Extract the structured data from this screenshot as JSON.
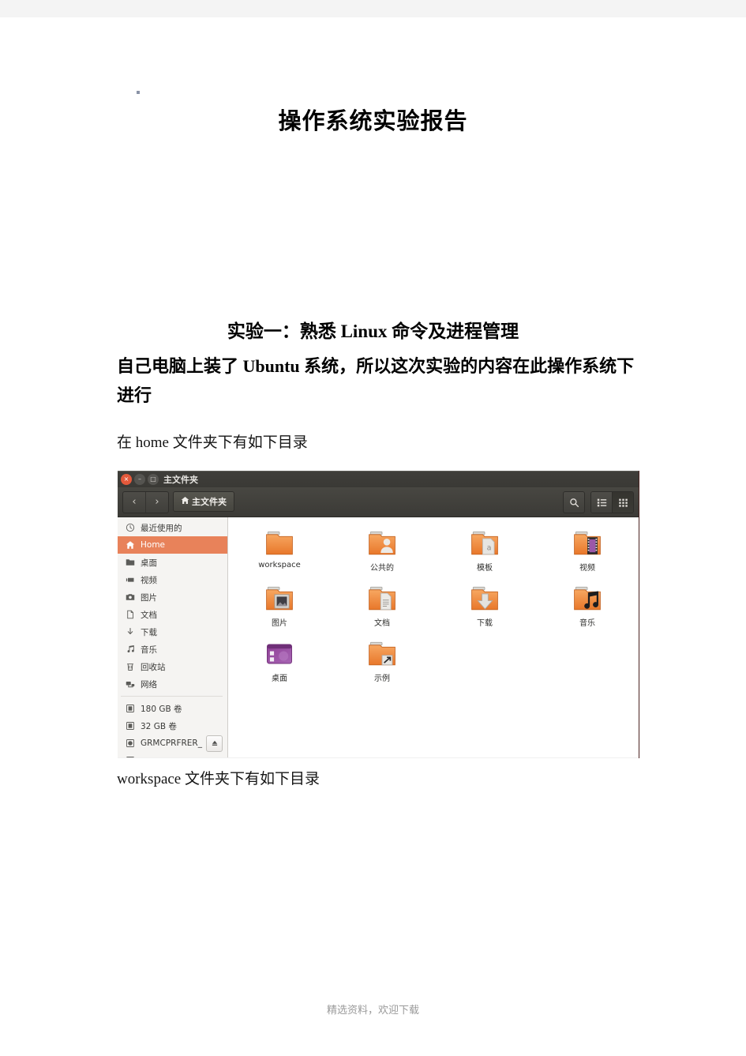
{
  "document": {
    "title": "操作系统实验报告",
    "heading": "实验一：熟悉 Linux 命令及进程管理",
    "paragraph_bold": "自己电脑上装了 Ubuntu 系统，所以这次实验的内容在此操作系统下进行",
    "paragraph_home": "在 home 文件夹下有如下目录",
    "paragraph_workspace": "workspace 文件夹下有如下目录",
    "footer": "精选资料，欢迎下载"
  },
  "screenshot": {
    "window_title": "主文件夹",
    "window_controls": {
      "close": "×",
      "minimize": "–",
      "maximize": "□"
    },
    "toolbar": {
      "back": "‹",
      "forward": "›",
      "path_button": "主文件夹",
      "search_icon": "search-icon",
      "list_view_icon": "list-view-icon",
      "grid_view_icon": "grid-view-icon",
      "active_view": "grid"
    },
    "sidebar": {
      "items": [
        {
          "label": "最近使用的",
          "icon": "clock-icon",
          "selected": false
        },
        {
          "label": "Home",
          "icon": "home-icon",
          "selected": true
        },
        {
          "label": "桌面",
          "icon": "folder-icon",
          "selected": false
        },
        {
          "label": "视频",
          "icon": "video-icon",
          "selected": false
        },
        {
          "label": "图片",
          "icon": "camera-icon",
          "selected": false
        },
        {
          "label": "文档",
          "icon": "document-icon",
          "selected": false
        },
        {
          "label": "下载",
          "icon": "download-icon",
          "selected": false
        },
        {
          "label": "音乐",
          "icon": "music-icon",
          "selected": false
        },
        {
          "label": "回收站",
          "icon": "trash-icon",
          "selected": false
        },
        {
          "label": "网络",
          "icon": "network-icon",
          "selected": false
        }
      ],
      "volumes": [
        {
          "label": "180 GB 卷",
          "icon": "drive-icon",
          "eject": false
        },
        {
          "label": "32 GB 卷",
          "icon": "drive-icon",
          "eject": false
        },
        {
          "label": "GRMCPRFRER_",
          "icon": "disc-icon",
          "eject": true
        }
      ]
    },
    "files": [
      {
        "label": "workspace",
        "icon": "folder-plain-icon"
      },
      {
        "label": "公共的",
        "icon": "folder-public-icon"
      },
      {
        "label": "模板",
        "icon": "folder-templates-icon"
      },
      {
        "label": "视频",
        "icon": "folder-videos-icon"
      },
      {
        "label": "图片",
        "icon": "folder-pictures-icon"
      },
      {
        "label": "文档",
        "icon": "folder-documents-icon"
      },
      {
        "label": "下载",
        "icon": "folder-downloads-icon"
      },
      {
        "label": "音乐",
        "icon": "folder-music-icon"
      },
      {
        "label": "桌面",
        "icon": "desktop-icon"
      },
      {
        "label": "示例",
        "icon": "folder-link-icon"
      }
    ],
    "colors": {
      "accent": "#e8825a",
      "titlebar": "#3b3a36",
      "folder": "#f0882c",
      "close_button": "#e4593b"
    }
  }
}
